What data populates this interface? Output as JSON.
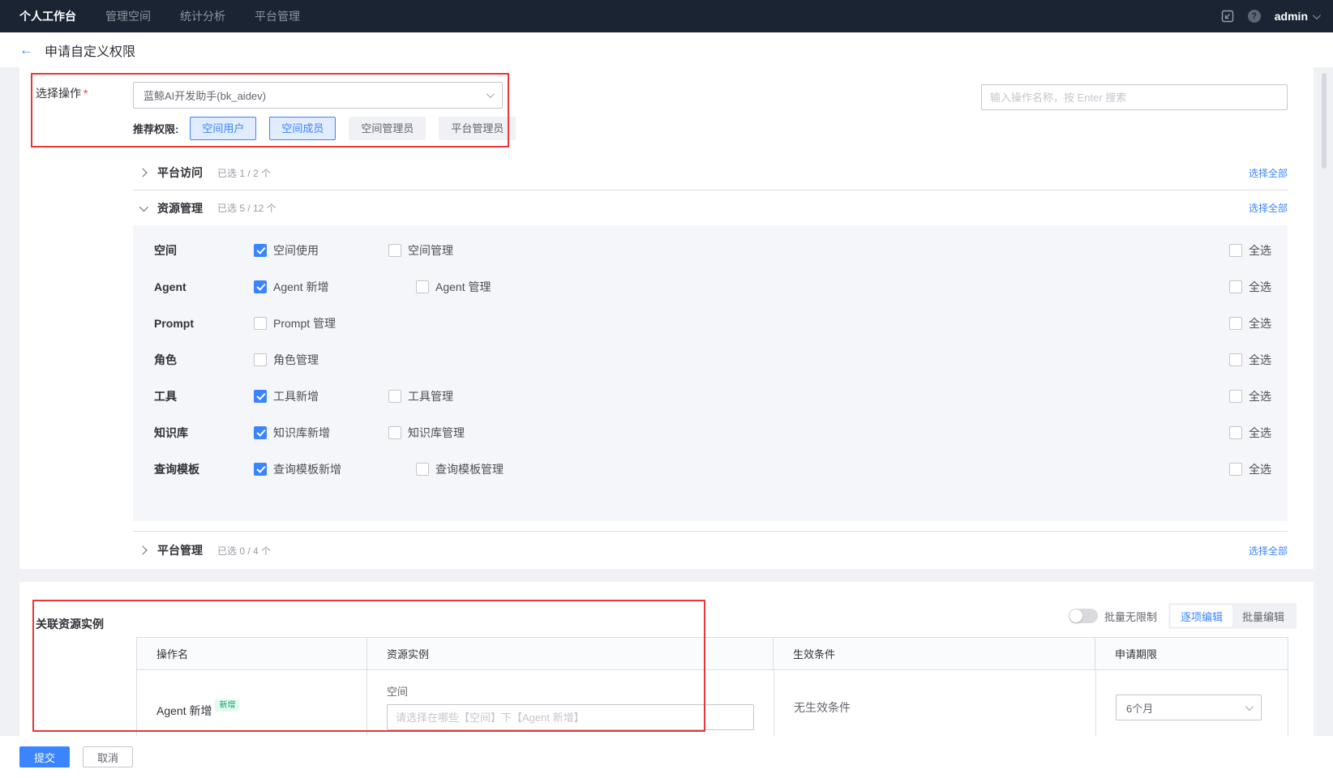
{
  "navbar": {
    "items": [
      {
        "label": "个人工作台",
        "active": true
      },
      {
        "label": "管理空间",
        "active": false
      },
      {
        "label": "统计分析",
        "active": false
      },
      {
        "label": "平台管理",
        "active": false
      }
    ],
    "user": "admin",
    "icons": {
      "workbench": "workbench-icon",
      "help": "help-icon",
      "user_caret": "chevron-down-icon"
    }
  },
  "page": {
    "title": "申请自定义权限",
    "back_icon": "arrow-left-icon"
  },
  "action_select": {
    "label": "选择操作",
    "required_mark": "*",
    "selected": "蓝鲸AI开发助手(bk_aidev)",
    "recommend_label": "推荐权限:",
    "recommend_tags": [
      {
        "label": "空间用户",
        "active": true
      },
      {
        "label": "空间成员",
        "active": true
      },
      {
        "label": "空间管理员",
        "active": false
      },
      {
        "label": "平台管理员",
        "active": false
      }
    ]
  },
  "search": {
    "placeholder": "输入操作名称，按 Enter 搜索"
  },
  "select_all_row_label": "全选",
  "groups": [
    {
      "name": "平台访问",
      "selected_text": "已选 1 / 2 个",
      "expanded": false,
      "select_all": "选择全部"
    },
    {
      "name": "资源管理",
      "selected_text": "已选 5 / 12 个",
      "expanded": true,
      "select_all": "选择全部",
      "rows": [
        {
          "label": "空间",
          "options": [
            {
              "label": "空间使用",
              "checked": true
            },
            {
              "label": "空间管理",
              "checked": false
            }
          ]
        },
        {
          "label": "Agent",
          "options": [
            {
              "label": "Agent 新增",
              "checked": true
            },
            {
              "label": "Agent 管理",
              "checked": false
            }
          ]
        },
        {
          "label": "Prompt",
          "options": [
            {
              "label": "Prompt 管理",
              "checked": false
            }
          ]
        },
        {
          "label": "角色",
          "options": [
            {
              "label": "角色管理",
              "checked": false
            }
          ]
        },
        {
          "label": "工具",
          "options": [
            {
              "label": "工具新增",
              "checked": true
            },
            {
              "label": "工具管理",
              "checked": false
            }
          ]
        },
        {
          "label": "知识库",
          "options": [
            {
              "label": "知识库新增",
              "checked": true
            },
            {
              "label": "知识库管理",
              "checked": false
            }
          ]
        },
        {
          "label": "查询模板",
          "options": [
            {
              "label": "查询模板新增",
              "checked": true
            },
            {
              "label": "查询模板管理",
              "checked": false
            }
          ]
        }
      ]
    },
    {
      "name": "平台管理",
      "selected_text": "已选 0 / 4 个",
      "expanded": false,
      "select_all": "选择全部"
    }
  ],
  "resource_section": {
    "title": "关联资源实例",
    "batch_toggle_label": "批量无限制",
    "batch_toggle_on": false,
    "edit_modes": [
      {
        "label": "逐项编辑",
        "active": true
      },
      {
        "label": "批量编辑",
        "active": false
      }
    ],
    "table": {
      "headers": [
        "操作名",
        "资源实例",
        "生效条件",
        "申请期限"
      ],
      "row": {
        "action": "Agent 新增",
        "badge": "新增",
        "resource_type": "空间",
        "resource_placeholder": "请选择在哪些【空间】下【Agent 新增】",
        "condition": "无生效条件",
        "period": "6个月"
      }
    }
  },
  "footer": {
    "submit": "提交",
    "cancel": "取消"
  },
  "colors": {
    "primary": "#3a84ff",
    "danger": "#ea3636",
    "navbar_bg": "#1b2432",
    "badge_text": "#14a568",
    "badge_bg": "#e4faf0"
  }
}
